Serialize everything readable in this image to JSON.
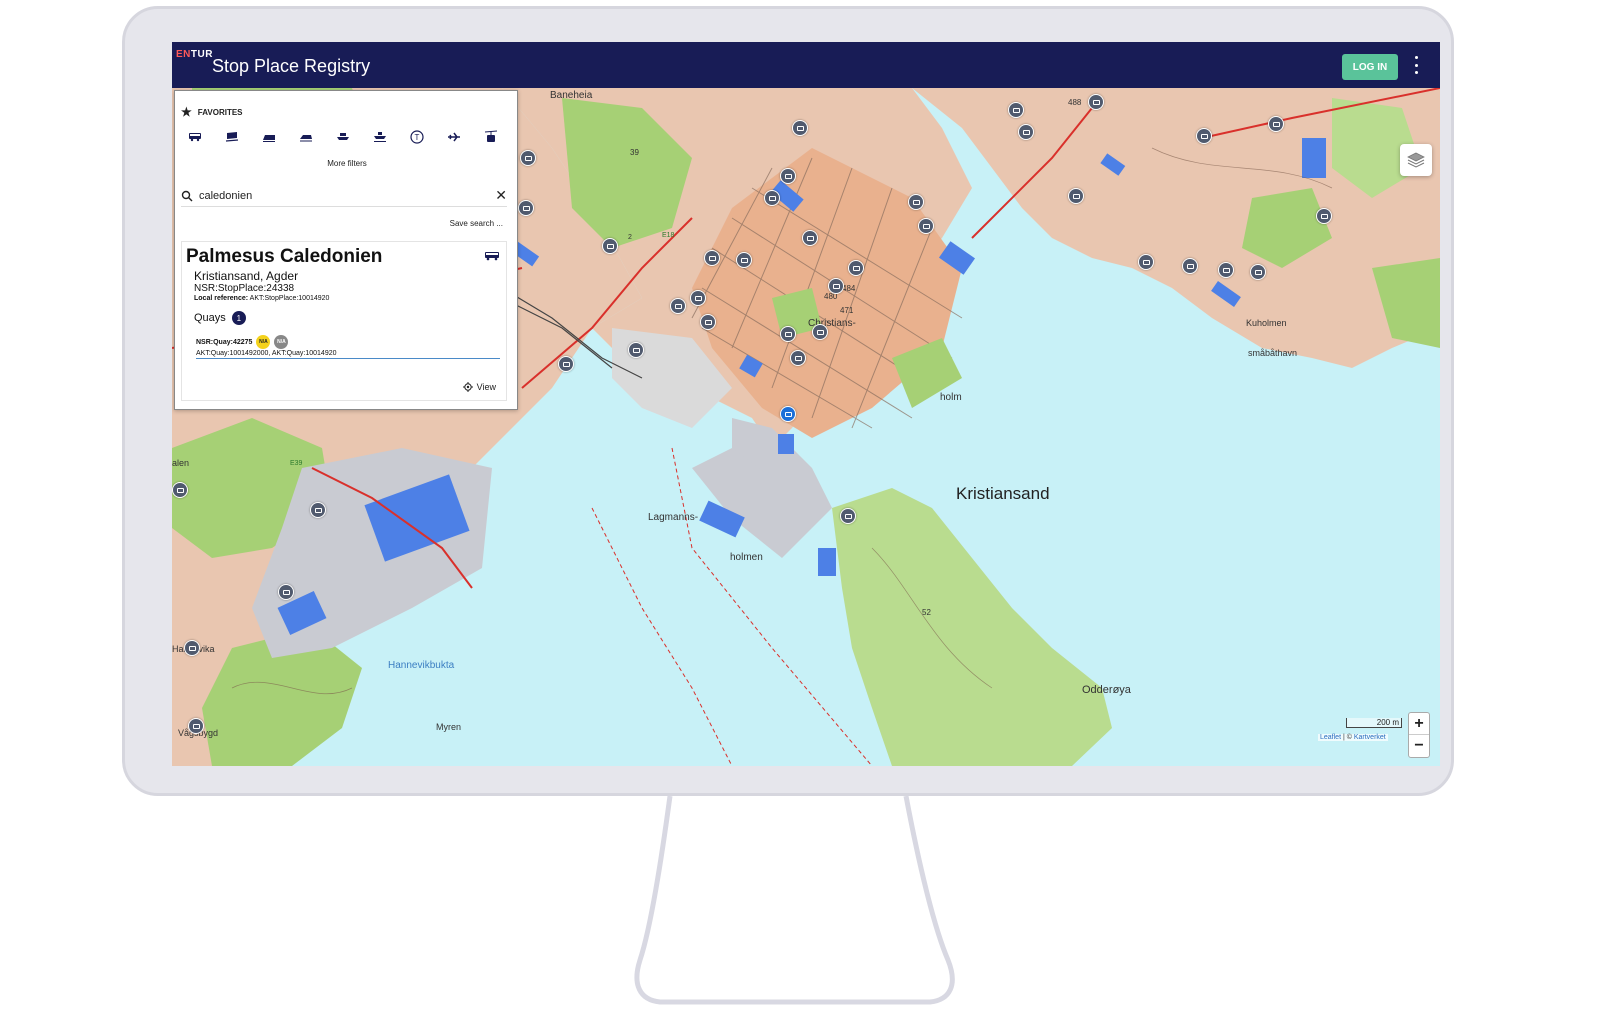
{
  "app": {
    "logo_en": "EN",
    "logo_tur": "TUR",
    "title": "Stop Place Registry",
    "login_label": "LOG IN"
  },
  "search_panel": {
    "favorites_label": "FAVORITES",
    "mode_icons": [
      "bus-icon",
      "train-icon",
      "tram-icon",
      "metro-icon",
      "ferry-icon",
      "water-icon",
      "taxi-icon",
      "airplane-icon",
      "cableway-icon"
    ],
    "more_filters_label": "More filters",
    "search_value": "caledonien",
    "save_search_label": "Save search ...",
    "result": {
      "name": "Palmesus Caledonien",
      "location": "Kristiansand, Agder",
      "id": "NSR:StopPlace:24338",
      "local_ref_label": "Local reference:",
      "local_ref_value": "AKT:StopPlace:10014920",
      "quays_label": "Quays",
      "quays_count": "1",
      "quay_id": "NSR:Quay:42275",
      "badge_1": "N/A",
      "badge_2": "N/A",
      "quay_refs": "AKT:Quay:1001492000, AKT:Quay:10014920",
      "view_label": "View"
    }
  },
  "map": {
    "labels": {
      "baneheia": "Baneheia",
      "kristiansand": "Kristiansand",
      "christians": "Christians-",
      "holm": "holm",
      "lagmanns": "Lagmanns-",
      "holmen": "holmen",
      "hannevikbukta": "Hannevikbukta",
      "odderoya": "Odderøya",
      "kuholmen": "Kuholmen",
      "smabathavn": "småbåthavn",
      "myren": "Myren",
      "vagsbygd": "Vågsbygd",
      "alen": "alen",
      "hannevika": "Hannevika",
      "num_488": "488",
      "num_484": "484",
      "num_471": "471",
      "num_480": "480",
      "num_52": "52",
      "num_39": "39",
      "num_2": "2",
      "e18": "E18",
      "e39": "E39"
    },
    "zoom_in": "+",
    "zoom_out": "−",
    "scale_label": "200 m",
    "attribution_leaflet": "Leaflet",
    "attribution_sep": " | © ",
    "attribution_source": "Kartverket"
  },
  "colors": {
    "topbar": "#181c56",
    "login": "#5ac39a",
    "water": "#c8f1f7",
    "urban": "#e9b18e",
    "forest": "#a6d075",
    "rock": "#e9c6b0",
    "industrial": "#c9cbd2",
    "building": "#4d80e6"
  }
}
